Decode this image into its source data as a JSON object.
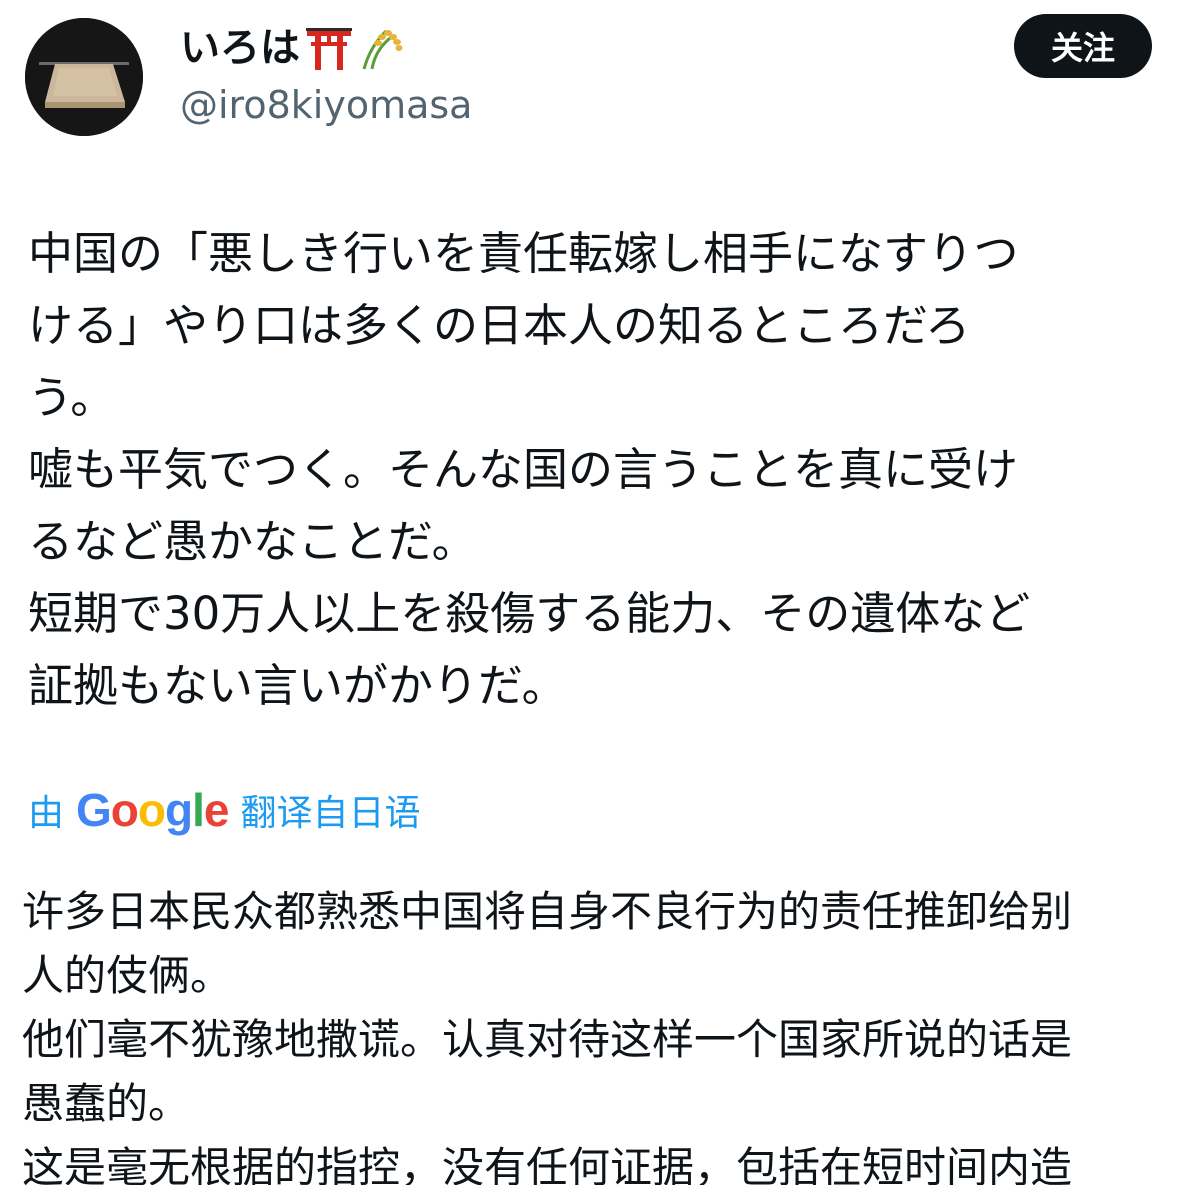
{
  "header": {
    "display_name": "いろは",
    "emojis": [
      "torii-icon",
      "rice-plant-icon"
    ],
    "handle": "@iro8kiyomasa",
    "follow_label": "关注"
  },
  "tweet": {
    "lines": [
      "中国の「悪しき行いを責任転嫁し相手になすりつ",
      "ける」やり口は多くの日本人の知るところだろ",
      "う。",
      "嘘も平気でつく。そんな国の言うことを真に受け",
      "るなど愚かなことだ。",
      "短期で30万人以上を殺傷する能力、その遺体など",
      "証拠もない言いがかりだ。"
    ]
  },
  "translation": {
    "by_label": "由",
    "provider": "Google",
    "from_label": "翻译自日语",
    "lines": [
      "许多日本民众都熟悉中国将自身不良行为的责任推卸给别",
      "人的伎俩。",
      "他们毫不犹豫地撒谎。认真对待这样一个国家所说的话是",
      "愚蠢的。",
      "这是毫无根据的指控，没有任何证据，包括在短时间内造"
    ]
  },
  "colors": {
    "text": "#0f1419",
    "secondary": "#536471",
    "link": "#1d9bf0",
    "button_bg": "#0f1419",
    "button_text": "#ffffff"
  }
}
